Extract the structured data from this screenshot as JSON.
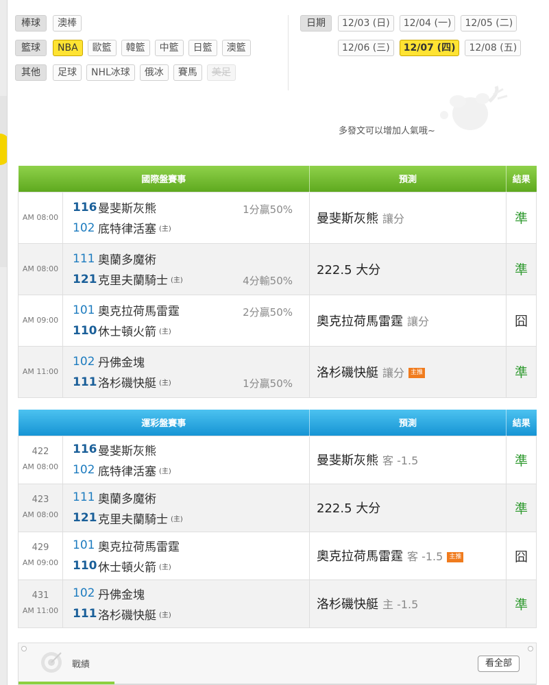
{
  "sports": {
    "baseball": {
      "label": "棒球",
      "items": [
        {
          "label": "澳棒",
          "active": false,
          "disabled": false
        }
      ]
    },
    "basketball": {
      "label": "籃球",
      "items": [
        {
          "label": "NBA",
          "active": true,
          "disabled": false
        },
        {
          "label": "歐籃",
          "active": false,
          "disabled": false
        },
        {
          "label": "韓籃",
          "active": false,
          "disabled": false
        },
        {
          "label": "中籃",
          "active": false,
          "disabled": false
        },
        {
          "label": "日籃",
          "active": false,
          "disabled": false
        },
        {
          "label": "澳籃",
          "active": false,
          "disabled": false
        }
      ]
    },
    "other": {
      "label": "其他",
      "items": [
        {
          "label": "足球",
          "active": false,
          "disabled": false
        },
        {
          "label": "NHL冰球",
          "active": false,
          "disabled": false
        },
        {
          "label": "俄冰",
          "active": false,
          "disabled": false
        },
        {
          "label": "賽馬",
          "active": false,
          "disabled": false
        },
        {
          "label": "美足",
          "active": false,
          "disabled": true
        }
      ]
    }
  },
  "dates": {
    "label": "日期",
    "items": [
      {
        "label": "12/03 (日)",
        "active": false
      },
      {
        "label": "12/04 (一)",
        "active": false
      },
      {
        "label": "12/05 (二)",
        "active": false
      },
      {
        "label": "12/06 (三)",
        "active": false
      },
      {
        "label": "12/07 (四)",
        "active": true
      },
      {
        "label": "12/08 (五)",
        "active": false
      }
    ]
  },
  "post_hint": "多發文可以增加人氣哦~",
  "intl_table": {
    "headers": [
      "國際盤賽事",
      "預測",
      "結果"
    ],
    "rows": [
      {
        "time": "AM 08:00",
        "away_score": "116",
        "away_name": "曼斐斯灰熊",
        "away_win": true,
        "home_score": "102",
        "home_name": "底特律活塞",
        "home_win": false,
        "home_tag": "(主)",
        "note": "1分贏50%",
        "note_pos": "top",
        "pred_main": "曼斐斯灰熊",
        "pred_sub": "讓分",
        "hot": "",
        "result": "準",
        "result_ok": true
      },
      {
        "time": "AM 08:00",
        "away_score": "111",
        "away_name": "奧蘭多魔術",
        "away_win": false,
        "home_score": "121",
        "home_name": "克里夫蘭騎士",
        "home_win": true,
        "home_tag": "(主)",
        "note": "4分輸50%",
        "note_pos": "bottom",
        "pred_main": "222.5 大分",
        "pred_sub": "",
        "hot": "",
        "result": "準",
        "result_ok": true
      },
      {
        "time": "AM 09:00",
        "away_score": "101",
        "away_name": "奧克拉荷馬雷霆",
        "away_win": false,
        "home_score": "110",
        "home_name": "休士頓火箭",
        "home_win": true,
        "home_tag": "(主)",
        "note": "2分贏50%",
        "note_pos": "top",
        "pred_main": "奧克拉荷馬雷霆",
        "pred_sub": "讓分",
        "hot": "",
        "result": "囧",
        "result_ok": false
      },
      {
        "time": "AM 11:00",
        "away_score": "102",
        "away_name": "丹佛金塊",
        "away_win": false,
        "home_score": "111",
        "home_name": "洛杉磯快艇",
        "home_win": true,
        "home_tag": "(主)",
        "note": "1分贏50%",
        "note_pos": "bottom",
        "pred_main": "洛杉磯快艇",
        "pred_sub": "讓分",
        "hot": "主推",
        "result": "準",
        "result_ok": true
      }
    ]
  },
  "lottery_table": {
    "headers": [
      "運彩盤賽事",
      "預測",
      "結果"
    ],
    "rows": [
      {
        "code": "422",
        "time": "AM 08:00",
        "away_score": "116",
        "away_name": "曼斐斯灰熊",
        "away_win": true,
        "home_score": "102",
        "home_name": "底特律活塞",
        "home_win": false,
        "home_tag": "(主)",
        "pred_main": "曼斐斯灰熊",
        "pred_sub": "客 -1.5",
        "hot": "",
        "result": "準",
        "result_ok": true
      },
      {
        "code": "423",
        "time": "AM 08:00",
        "away_score": "111",
        "away_name": "奧蘭多魔術",
        "away_win": false,
        "home_score": "121",
        "home_name": "克里夫蘭騎士",
        "home_win": true,
        "home_tag": "(主)",
        "pred_main": "222.5 大分",
        "pred_sub": "",
        "hot": "",
        "result": "準",
        "result_ok": true
      },
      {
        "code": "429",
        "time": "AM 09:00",
        "away_score": "101",
        "away_name": "奧克拉荷馬雷霆",
        "away_win": false,
        "home_score": "110",
        "home_name": "休士頓火箭",
        "home_win": true,
        "home_tag": "(主)",
        "pred_main": "奧克拉荷馬雷霆",
        "pred_sub": "客 -1.5",
        "hot": "主推",
        "result": "囧",
        "result_ok": false
      },
      {
        "code": "431",
        "time": "AM 11:00",
        "away_score": "102",
        "away_name": "丹佛金塊",
        "away_win": false,
        "home_score": "111",
        "home_name": "洛杉磯快艇",
        "home_win": true,
        "home_tag": "(主)",
        "pred_main": "洛杉磯快艇",
        "pred_sub": "主 -1.5",
        "hot": "",
        "result": "準",
        "result_ok": true
      }
    ]
  },
  "record": {
    "title": "戰績",
    "view_all": "看全部"
  }
}
